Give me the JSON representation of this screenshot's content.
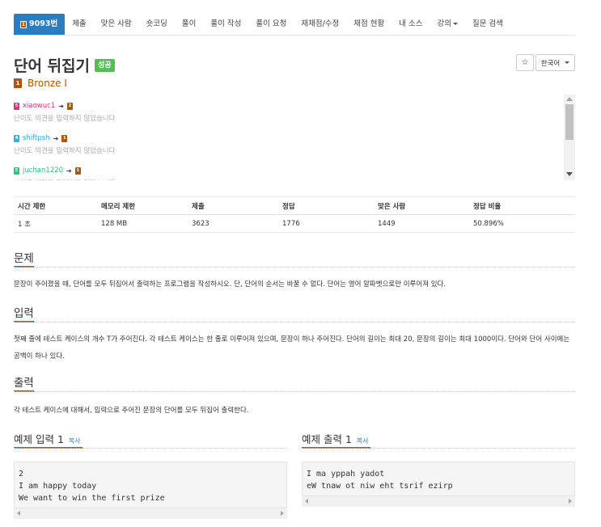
{
  "tabs": [
    {
      "label": "9093번",
      "active": true
    },
    {
      "label": "제출"
    },
    {
      "label": "맞은 사람"
    },
    {
      "label": "숏코딩"
    },
    {
      "label": "풀이"
    },
    {
      "label": "풀이 작성"
    },
    {
      "label": "풀이 요청"
    },
    {
      "label": "재채점/수정"
    },
    {
      "label": "채점 현황"
    },
    {
      "label": "내 소스"
    },
    {
      "label": "강의",
      "dropdown": true
    },
    {
      "label": "질문 검색"
    }
  ],
  "tab_badge": "1",
  "title": "단어 뒤집기",
  "status_badge": "성공",
  "star_icon": "star-icon",
  "language": "한국어",
  "tier": {
    "label": "Bronze I",
    "icon_text": "1",
    "color": "#ad5600"
  },
  "votes": [
    {
      "user": "xiaowuc1",
      "user_color": "#e0336f",
      "from_level": "5",
      "from_color": "#e0336f",
      "to_level": "2",
      "to_color": "#ad5600",
      "comment": "난이도 의견을 입력하지 않았습니다"
    },
    {
      "user": "shiftpsh",
      "user_color": "#27b5e6",
      "from_level": "4",
      "from_color": "#27b5e6",
      "to_level": "1",
      "to_color": "#ad5600",
      "comment": "난이도 의견을 입력하지 않았습니다"
    },
    {
      "user": "juchan1220",
      "user_color": "#27c77e",
      "from_level": "5",
      "from_color": "#27c77e",
      "to_level": "1",
      "to_color": "#ad5600",
      "comment": "난이도 의견을 입력하지 않았습니다"
    }
  ],
  "stats": {
    "headers": [
      "시간 제한",
      "메모리 제한",
      "제출",
      "정답",
      "맞은 사람",
      "정답 비율"
    ],
    "row": [
      "1 초",
      "128 MB",
      "3623",
      "1776",
      "1449",
      "50.896%"
    ]
  },
  "problem": {
    "heading": "문제",
    "text": "문장이 주어졌을 때, 단어를 모두 뒤집어서 출력하는 프로그램을 작성하시오. 단, 단어의 순서는 바꿀 수 없다. 단어는 영어 알파벳으로만 이루어져 있다."
  },
  "input": {
    "heading": "입력",
    "text": "첫째 줄에 테스트 케이스의 개수 T가 주어진다. 각 테스트 케이스는 한 줄로 이루어져 있으며, 문장이 하나 주어진다. 단어의 길이는 최대 20, 문장의 길이는 최대 1000이다. 단어와 단어 사이에는 공백이 하나 있다."
  },
  "output": {
    "heading": "출력",
    "text": "각 테스트 케이스에 대해서, 입력으로 주어진 문장의 단어를 모두 뒤집어 출력한다."
  },
  "sample_input": {
    "heading": "예제 입력 1",
    "copy": "복사",
    "content": "2\nI am happy today\nWe want to win the first prize"
  },
  "sample_output": {
    "heading": "예제 출력 1",
    "copy": "복사",
    "content": "I ma yppah yadot\neW tnaw ot niw eht tsrif ezirp"
  }
}
